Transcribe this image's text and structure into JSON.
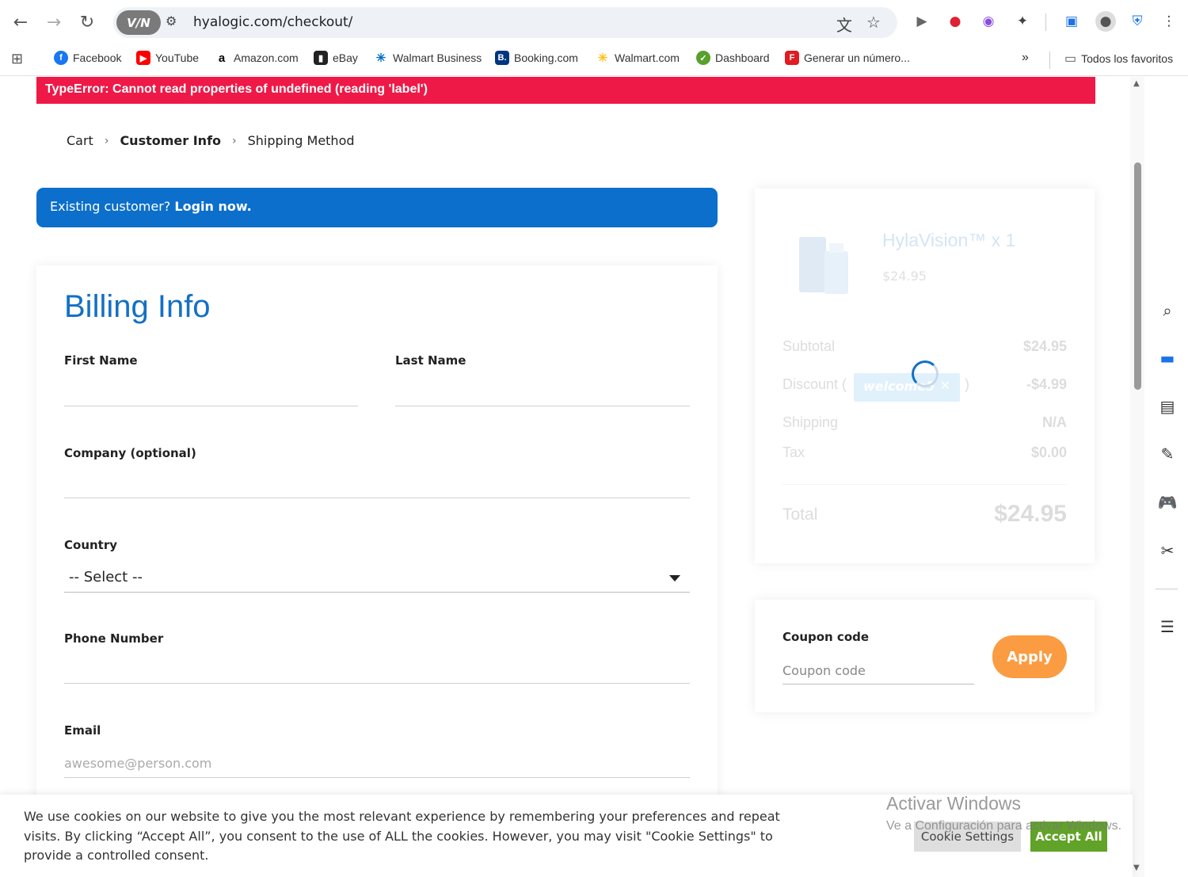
{
  "browser": {
    "url": "hyalogic.com/checkout/",
    "vpn_label": "V/N",
    "bookmarks": [
      {
        "label": "Facebook",
        "icon": "facebook-icon",
        "color": "#1877f2"
      },
      {
        "label": "YouTube",
        "icon": "youtube-icon",
        "color": "#ff0000"
      },
      {
        "label": "Amazon.com",
        "icon": "amazon-icon",
        "color": "#000000"
      },
      {
        "label": "eBay",
        "icon": "ebay-icon",
        "color": "#e53238"
      },
      {
        "label": "Walmart Business",
        "icon": "walmart-icon",
        "color": "#0071ce"
      },
      {
        "label": "Booking.com",
        "icon": "booking-icon",
        "color": "#003580"
      },
      {
        "label": "Walmart.com",
        "icon": "walmart-spark-icon",
        "color": "#ffc220"
      },
      {
        "label": "Dashboard",
        "icon": "dashboard-icon",
        "color": "#5aa02c"
      },
      {
        "label": "Generar un número...",
        "icon": "generar-icon",
        "color": "#e01b22"
      }
    ],
    "all_bookmarks_label": "Todos los favoritos"
  },
  "error": {
    "message": "TypeError: Cannot read properties of undefined (reading 'label')"
  },
  "breadcrumb": {
    "items": [
      "Cart",
      "Customer Info",
      "Shipping Method"
    ],
    "current_index": 1
  },
  "login_banner": {
    "prefix": "Existing customer? ",
    "link": "Login now."
  },
  "billing": {
    "title": "Billing Info",
    "first_name_label": "First Name",
    "last_name_label": "Last Name",
    "company_label": "Company (optional)",
    "country_label": "Country",
    "country_selected": "-- Select --",
    "phone_label": "Phone Number",
    "email_label": "Email",
    "email_placeholder": "awesome@person.com"
  },
  "summary": {
    "product_title": "HylaVision™ x 1",
    "product_price": "$24.95",
    "subtotal_label": "Subtotal",
    "subtotal_value": "$24.95",
    "discount_label": "Discount (",
    "discount_close": ")",
    "discount_code": "welcome5",
    "discount_value": "-$4.99",
    "shipping_label": "Shipping",
    "shipping_value": "N/A",
    "tax_label": "Tax",
    "tax_value": "$0.00",
    "total_label": "Total",
    "total_value": "$24.95"
  },
  "coupon": {
    "label": "Coupon code",
    "placeholder": "Coupon code",
    "apply_label": "Apply"
  },
  "cookie": {
    "text": "We use cookies on our website to give you the most relevant experience by remembering your preferences and repeat visits. By clicking “Accept All”, you consent to the use of ALL the cookies. However, you may visit \"Cookie Settings\" to provide a controlled consent.",
    "settings_label": "Cookie Settings",
    "accept_label": "Accept All"
  },
  "watermark": {
    "line1": "Activar Windows",
    "line2": "Ve a Configuración para activar Windows."
  },
  "colors": {
    "error": "#ee1947",
    "primary": "#1470c4",
    "banner": "#0b6fcb",
    "apply": "#fb9b42",
    "accept": "#61a229"
  }
}
